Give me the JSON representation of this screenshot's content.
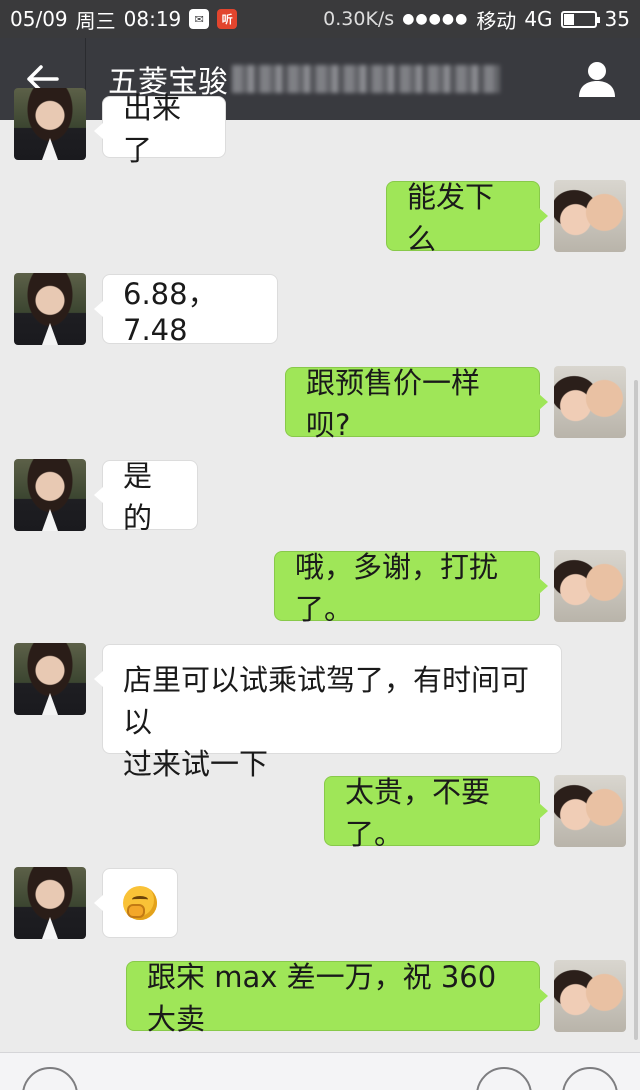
{
  "status_bar": {
    "date": "05/09",
    "weekday": "周三",
    "time": "08:19",
    "notif_1": "✉",
    "notif_2": "听",
    "speed": "0.30K/s",
    "signal_dots": "●●●●●",
    "carrier": "移动",
    "network": "4G",
    "battery_level": 0.35,
    "battery_text": "35"
  },
  "header": {
    "title_visible": "五菱宝骏"
  },
  "messages": [
    {
      "side": "left",
      "text": "出来了"
    },
    {
      "side": "right",
      "text": "能发下么"
    },
    {
      "side": "left",
      "text": "6.88，7.48"
    },
    {
      "side": "right",
      "text": "跟预售价一样呗?"
    },
    {
      "side": "left",
      "text": "是的"
    },
    {
      "side": "right",
      "text": "哦，多谢，打扰了。"
    },
    {
      "side": "left",
      "line1": "店里可以试乘试驾了，有时间可以",
      "line2": "过来试一下"
    },
    {
      "side": "right",
      "text": "太贵，不要了。"
    },
    {
      "side": "left",
      "emoji": "thinking-face"
    },
    {
      "side": "right",
      "text": "跟宋 max 差一万，祝 360 大卖"
    }
  ],
  "colors": {
    "header_bg": "#393a3f",
    "chat_bg": "#ebebeb",
    "outgoing_bubble": "#9fe658",
    "incoming_bubble": "#ffffff"
  }
}
